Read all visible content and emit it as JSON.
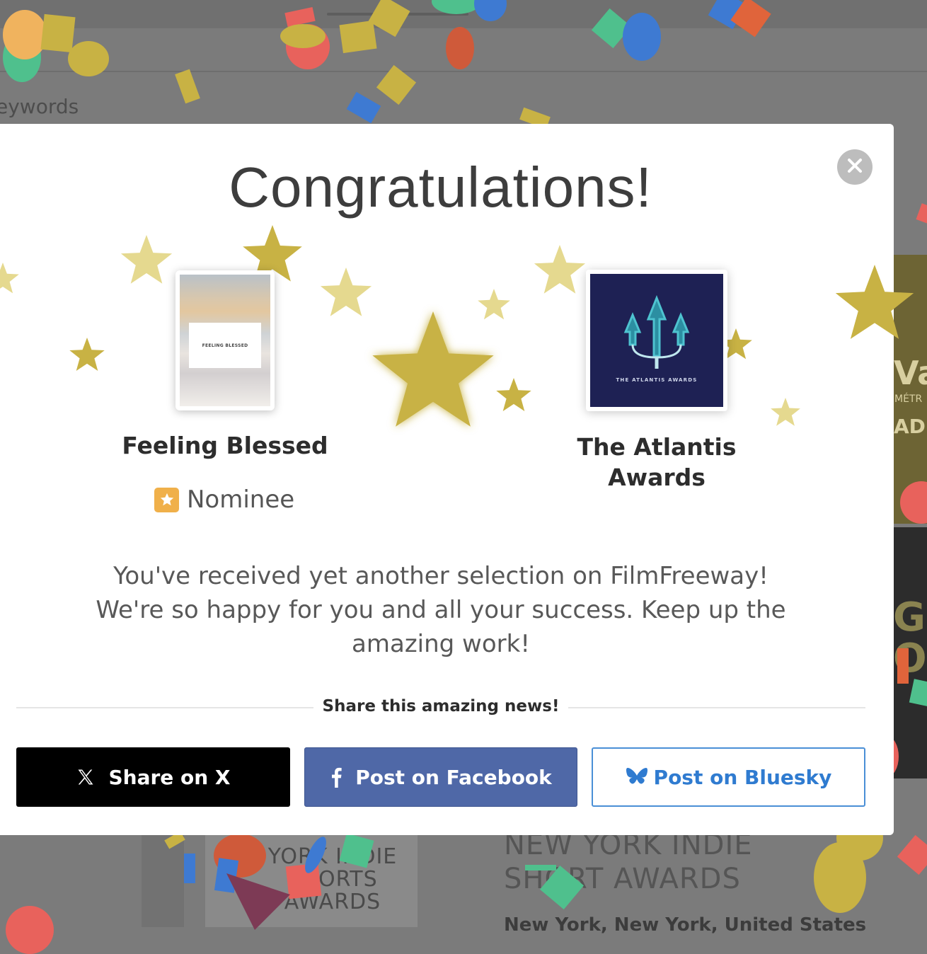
{
  "background": {
    "search_placeholder_fragment": "eywords",
    "listing_title": "NEW YORK INDIE SHORT AWARDS",
    "listing_location": "New York, New York, United States",
    "thumb_text": "YORK INDIE SHORTS AWARDS",
    "right_fragment_1": "Va",
    "right_fragment_2": "MÉTR",
    "right_fragment_3": "ADLI",
    "right_fragment_4": "GO",
    "right_fragment_5": "ON"
  },
  "modal": {
    "title": "Congratulations!",
    "project": {
      "title": "Feeling Blessed",
      "poster_text": "FEELING BLESSED"
    },
    "festival": {
      "title": "The Atlantis Awards",
      "logo_text": "THE ATLANTIS AWARDS"
    },
    "status": {
      "label": "Nominee",
      "icon": "star-badge-icon",
      "color": "#f0b04a"
    },
    "message": "You've received yet another selection on FilmFreeway! We're so happy for you and all your success. Keep up the amazing work!",
    "share_heading": "Share this amazing news!",
    "buttons": {
      "x": {
        "label": "Share on X",
        "icon": "x-logo-icon",
        "color": "#000000"
      },
      "facebook": {
        "label": "Post on Facebook",
        "icon": "facebook-icon",
        "color": "#4f68a7"
      },
      "bluesky": {
        "label": "Post on Bluesky",
        "icon": "bluesky-butterfly-icon",
        "color": "#2f7bd0"
      }
    },
    "close": {
      "icon": "close-icon"
    }
  },
  "colors": {
    "star_gold": "#c8b244",
    "star_light": "#e5d98f",
    "overlay": "#7b7b7b"
  }
}
